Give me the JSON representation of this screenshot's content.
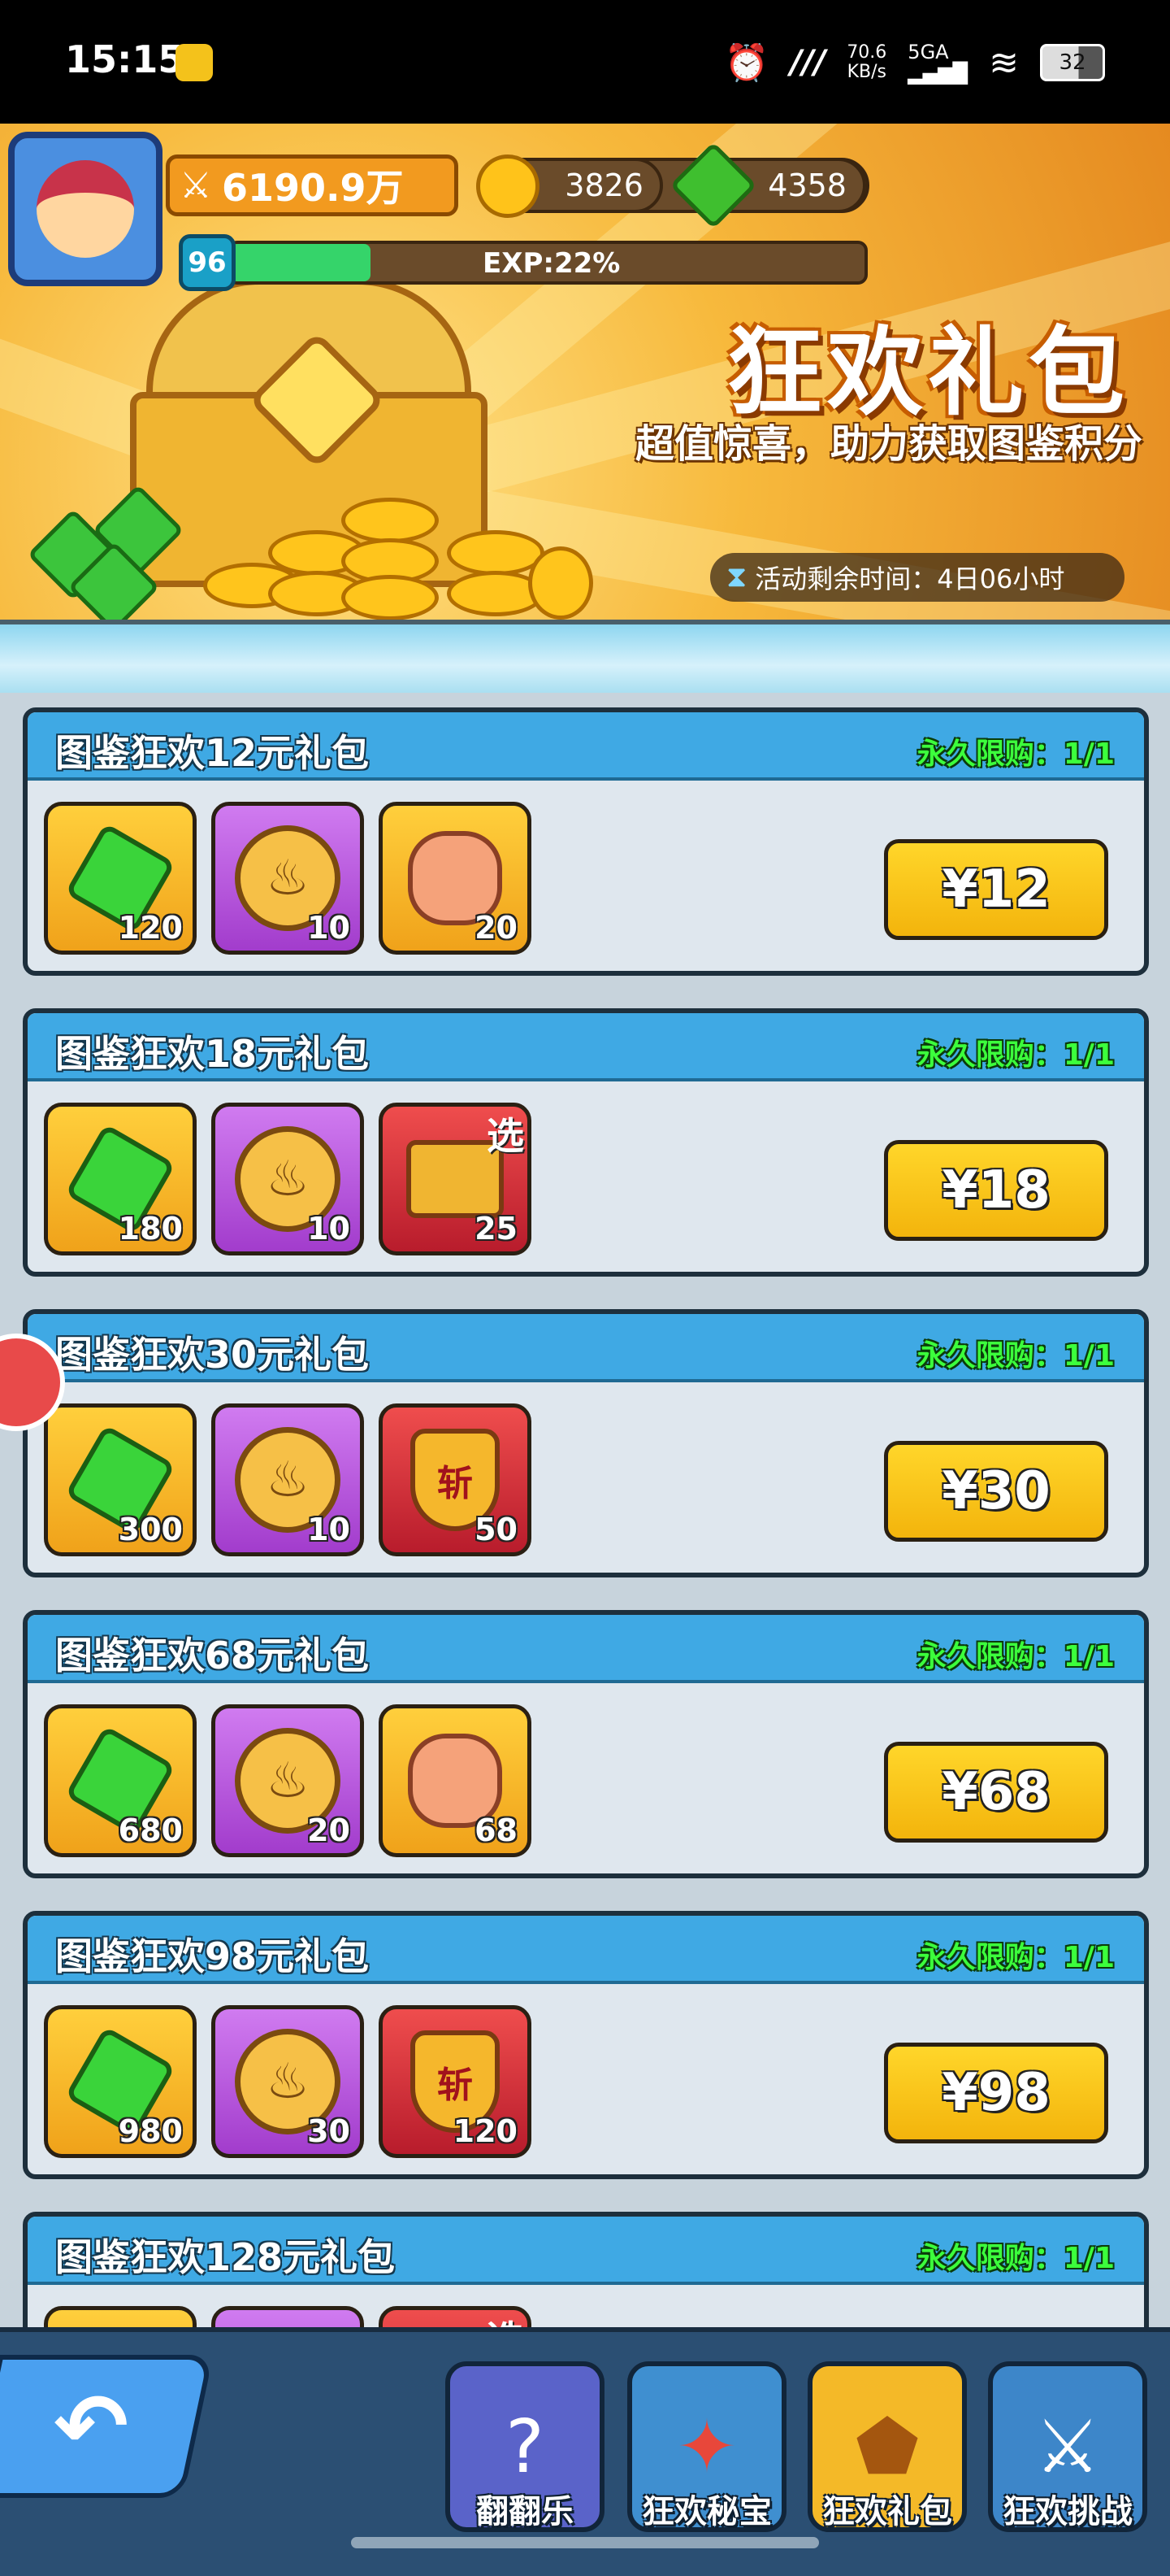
{
  "status_bar": {
    "time": "15:15",
    "net_speed_value": "70.6",
    "net_speed_unit": "KB/s",
    "network": "5GA",
    "battery": "32"
  },
  "player": {
    "power": "6190.9万",
    "coins": "3826",
    "gems": "4358",
    "level": "96",
    "exp_label": "EXP:22%",
    "exp_percent": 22
  },
  "banner": {
    "title": "狂欢礼包",
    "subtitle": "超值惊喜，助力获取图鉴积分",
    "timer_label": "活动剩余时间：4日06小时"
  },
  "packs": [
    {
      "name": "图鉴狂欢12元礼包",
      "limit": "永久限购：1/1",
      "price": "¥12",
      "items": [
        {
          "kind": "gem",
          "bg": "gold",
          "qty": "120"
        },
        {
          "kind": "coin",
          "bg": "purple",
          "qty": "10"
        },
        {
          "kind": "stone",
          "bg": "gold",
          "qty": "20"
        }
      ]
    },
    {
      "name": "图鉴狂欢18元礼包",
      "limit": "永久限购：1/1",
      "price": "¥18",
      "items": [
        {
          "kind": "gem",
          "bg": "gold",
          "qty": "180"
        },
        {
          "kind": "coin",
          "bg": "purple",
          "qty": "10"
        },
        {
          "kind": "chest",
          "bg": "red",
          "qty": "25",
          "tag": "选"
        }
      ]
    },
    {
      "name": "图鉴狂欢30元礼包",
      "limit": "永久限购：1/1",
      "price": "¥30",
      "items": [
        {
          "kind": "gem",
          "bg": "gold",
          "qty": "300"
        },
        {
          "kind": "coin",
          "bg": "purple",
          "qty": "10"
        },
        {
          "kind": "badge",
          "bg": "red",
          "qty": "50",
          "mark": "斩"
        }
      ]
    },
    {
      "name": "图鉴狂欢68元礼包",
      "limit": "永久限购：1/1",
      "price": "¥68",
      "items": [
        {
          "kind": "gem",
          "bg": "gold",
          "qty": "680"
        },
        {
          "kind": "coin",
          "bg": "purple",
          "qty": "20"
        },
        {
          "kind": "stone",
          "bg": "gold",
          "qty": "68"
        }
      ]
    },
    {
      "name": "图鉴狂欢98元礼包",
      "limit": "永久限购：1/1",
      "price": "¥98",
      "items": [
        {
          "kind": "gem",
          "bg": "gold",
          "qty": "980"
        },
        {
          "kind": "coin",
          "bg": "purple",
          "qty": "30"
        },
        {
          "kind": "badge",
          "bg": "red",
          "qty": "120",
          "mark": "斩"
        }
      ]
    },
    {
      "name": "图鉴狂欢128元礼包",
      "limit": "永久限购：1/1",
      "price": "",
      "items": [
        {
          "kind": "gem",
          "bg": "gold",
          "qty": ""
        },
        {
          "kind": "coin",
          "bg": "purple",
          "qty": ""
        },
        {
          "kind": "chest",
          "bg": "red",
          "qty": "",
          "tag": "选"
        }
      ]
    }
  ],
  "nav": {
    "back_icon": "back-arrow-icon",
    "tabs": [
      {
        "label": "翻翻乐",
        "icon": "card-flip-icon",
        "active": false
      },
      {
        "label": "狂欢秘宝",
        "icon": "treasure-icon",
        "active": false
      },
      {
        "label": "狂欢礼包",
        "icon": "gift-chest-icon",
        "active": true
      },
      {
        "label": "狂欢挑战",
        "icon": "crossed-swords-icon",
        "active": false
      }
    ]
  }
}
